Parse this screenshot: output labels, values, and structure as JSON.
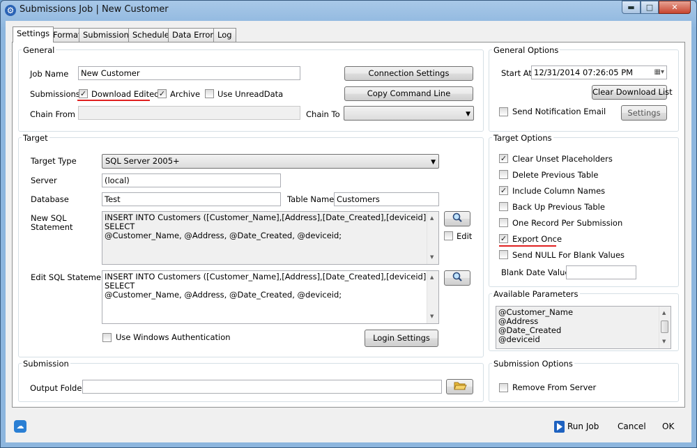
{
  "window": {
    "title": "Submissions Job | New Customer",
    "controls": {
      "minimize": "▬",
      "maximize": "□",
      "close": "✕"
    }
  },
  "tabs": [
    "Settings",
    "Format",
    "Submissions",
    "Schedule",
    "Data Errors",
    "Log"
  ],
  "general": {
    "title": "General",
    "job_name_label": "Job Name",
    "job_name_value": "New Customer",
    "submissions_label": "Submissions",
    "download_edited_label": "Download Edited",
    "download_edited_checked": true,
    "archive_label": "Archive",
    "archive_checked": true,
    "use_unread_label": "Use UnreadData",
    "use_unread_checked": false,
    "chain_from_label": "Chain From",
    "chain_from_value": "",
    "chain_to_label": "Chain To",
    "chain_to_value": "",
    "connection_settings_label": "Connection Settings",
    "copy_command_label": "Copy Command Line"
  },
  "general_options": {
    "title": "General Options",
    "start_at_label": "Start At",
    "start_at_value": "12/31/2014 07:26:05 PM",
    "clear_download_label": "Clear Download List",
    "send_email_label": "Send Notification Email",
    "send_email_checked": false,
    "settings_label": "Settings"
  },
  "target": {
    "title": "Target",
    "target_type_label": "Target Type",
    "target_type_value": "SQL Server 2005+",
    "server_label": "Server",
    "server_value": "(local)",
    "database_label": "Database",
    "database_value": "Test",
    "table_name_label": "Table Name",
    "table_name_value": "Customers",
    "new_sql_label_1": "New SQL",
    "new_sql_label_2": "Statement",
    "new_sql_value_1": "INSERT INTO Customers ([Customer_Name],[Address],[Date_Created],[deviceid]) SELECT",
    "new_sql_value_2": "@Customer_Name, @Address, @Date_Created, @deviceid;",
    "edit_label": "Edit",
    "edit_checked": false,
    "edit_sql_label": "Edit SQL Statement",
    "edit_sql_value_1": "INSERT INTO Customers ([Customer_Name],[Address],[Date_Created],[deviceid]) SELECT",
    "edit_sql_value_2": "@Customer_Name, @Address, @Date_Created, @deviceid;",
    "windows_auth_label": "Use Windows Authentication",
    "windows_auth_checked": false,
    "login_settings_label": "Login Settings"
  },
  "target_options": {
    "title": "Target Options",
    "items": [
      {
        "label": "Clear Unset Placeholders",
        "checked": true
      },
      {
        "label": "Delete Previous Table",
        "checked": false
      },
      {
        "label": "Include Column Names",
        "checked": true
      },
      {
        "label": "Back Up Previous Table",
        "checked": false
      },
      {
        "label": "One Record Per Submission",
        "checked": false
      },
      {
        "label": "Export Once",
        "checked": true
      },
      {
        "label": "Send NULL For Blank Values",
        "checked": false
      }
    ],
    "blank_date_label": "Blank Date Value",
    "blank_date_value": ""
  },
  "available_parameters": {
    "title": "Available Parameters",
    "items": [
      "@Customer_Name",
      "@Address",
      "@Date_Created",
      "@deviceid"
    ]
  },
  "submission": {
    "title": "Submission",
    "output_folder_label": "Output Folder",
    "output_folder_value": ""
  },
  "submission_options": {
    "title": "Submission Options",
    "remove_from_server_label": "Remove From Server",
    "remove_from_server_checked": false
  },
  "footer": {
    "run_job_label": "Run Job",
    "cancel_label": "Cancel",
    "ok_label": "OK"
  },
  "colors": {
    "highlight_underline": "#e02020",
    "accent": "#2a63b5"
  }
}
